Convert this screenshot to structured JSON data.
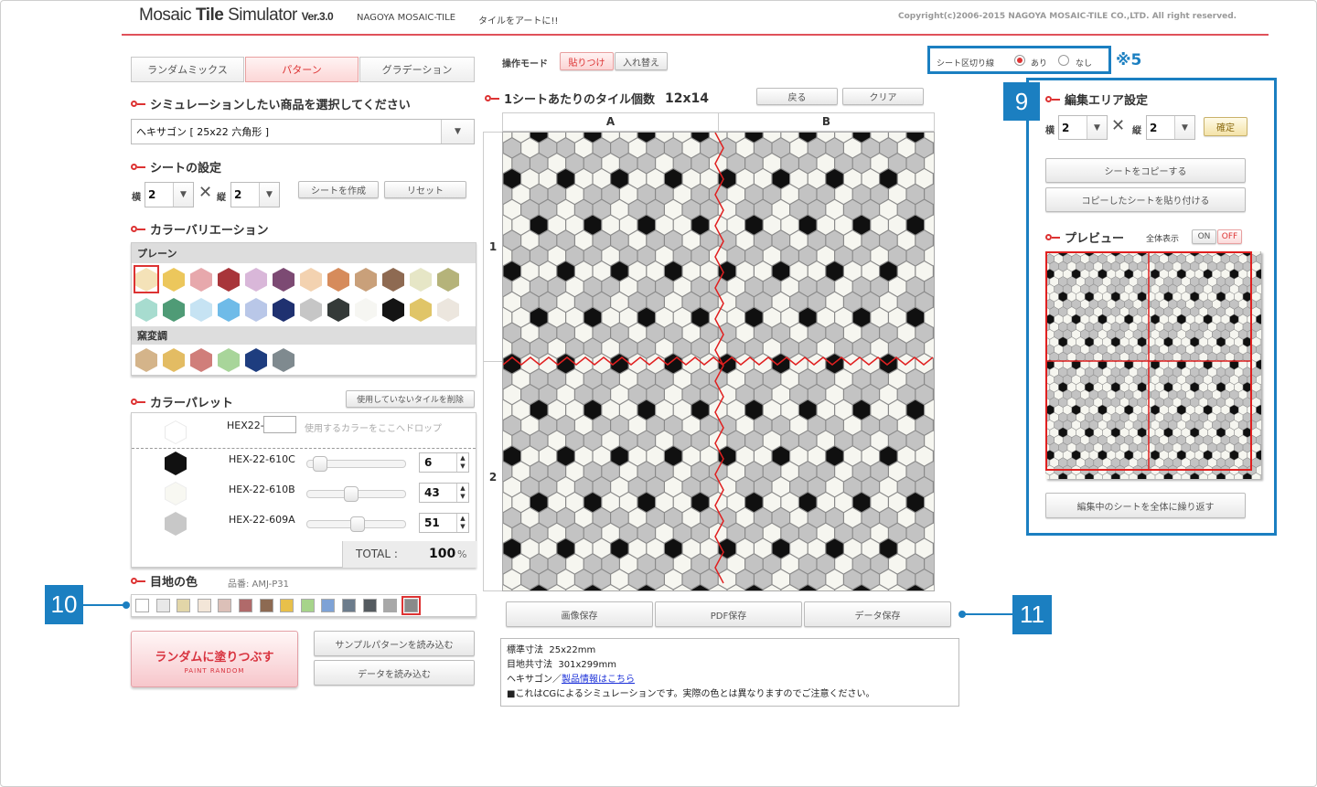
{
  "header": {
    "logo_main": "Mosaic ",
    "logo_bold": "Tile",
    "logo_rest": " Simulator ",
    "version": "Ver.3.0",
    "company": "NAGOYA MOSAIC-TILE",
    "slogan": "タイルをアートに!!",
    "copyright": "Copyright(c)2006-2015 NAGOYA MOSAIC-TILE CO.,LTD. All right reserved."
  },
  "tabs": [
    "ランダムミックス",
    "パターン",
    "グラデーション"
  ],
  "active_tab": 1,
  "product": {
    "title": "シミュレーションしたい商品を選択してください",
    "selected": "ヘキサゴン [ 25x22 六角形 ]"
  },
  "sheet": {
    "title": "シートの設定",
    "h_label": "横",
    "h_value": "2",
    "v_label": "縦",
    "v_value": "2",
    "create_btn": "シートを作成",
    "reset_btn": "リセット"
  },
  "variation": {
    "title": "カラーバリエーション",
    "group1": "プレーン",
    "group2": "窯変調",
    "row1": [
      "#f4e2b8",
      "#ecc75c",
      "#e7a8ac",
      "#a8353a",
      "#d9b7d9",
      "#7c4a73",
      "#f3d2b0",
      "#d68b5b",
      "#c9a07a",
      "#8e6a52",
      "#e6e6c6",
      "#b5b37a"
    ],
    "row2": [
      "#a7dccf",
      "#4f9b76",
      "#c6e3f3",
      "#6fbbe8",
      "#b9c7e8",
      "#1f3170",
      "#c6c6c6",
      "#343a38",
      "#f6f6f2",
      "#141414",
      "#e0c568",
      "#ece6de"
    ],
    "row3": [
      "#d4b48a",
      "#e3bc63",
      "#d07e7a",
      "#a8d59a",
      "#1e3d7f",
      "#7f8a8f"
    ]
  },
  "palette": {
    "title": "カラーパレット",
    "delete_btn": "使用していないタイルを削除",
    "drop_label": "HEX22-",
    "drop_hint": "使用するカラーをここへドロップ",
    "items": [
      {
        "code": "HEX-22-610C",
        "value": "6",
        "color": "#111111",
        "level": 0.06
      },
      {
        "code": "HEX-22-610B",
        "value": "43",
        "color": "#f8f8f2",
        "level": 0.43
      },
      {
        "code": "HEX-22-609A",
        "value": "51",
        "color": "#c8c8c8",
        "level": 0.51
      }
    ],
    "total_label": "TOTAL :",
    "total_value": "100",
    "total_unit": "%"
  },
  "grout": {
    "title": "目地の色",
    "code": "品番: AMJ-P31",
    "colors": [
      "#ffffff",
      "#e8e8e8",
      "#e2d6a8",
      "#f3e6d8",
      "#dcc0b8",
      "#b06a6a",
      "#8d6a52",
      "#e8c04a",
      "#a6d48a",
      "#7ea2d6",
      "#6c7c8c",
      "#555b60",
      "#a8a8a8",
      "#8a8a8a"
    ],
    "selected": 13
  },
  "random_btn": {
    "main": "ランダムに塗りつぶす",
    "sub": "PAINT RANDOM"
  },
  "load_sample_btn": "サンプルパターンを読み込む",
  "load_data_btn": "データを読み込む",
  "mode": {
    "label": "操作モード",
    "paste": "貼りつけ",
    "replace": "入れ替え"
  },
  "canvas": {
    "title": "1シートあたりのタイル個数",
    "count": "12x14",
    "back_btn": "戻る",
    "clear_btn": "クリア",
    "col_a": "A",
    "col_b": "B",
    "row_1": "1",
    "row_2": "2"
  },
  "save": {
    "image": "画像保存",
    "pdf": "PDF保存",
    "data": "データ保存"
  },
  "info": {
    "size_label": "標準寸法",
    "size": "25x22mm",
    "joint_label": "目地共寸法",
    "joint": "301x299mm",
    "product_prefix": "ヘキサゴン／",
    "product_link": "製品情報はこちら",
    "note": "■これはCGによるシミュレーションです。実際の色とは異なりますのでご注意ください。"
  },
  "divider": {
    "label": "シート区切り線",
    "yes": "あり",
    "no": "なし",
    "note": "※5"
  },
  "edit_area": {
    "title": "編集エリア設定",
    "h_label": "横",
    "h_value": "2",
    "v_label": "縦",
    "v_value": "2",
    "confirm": "確定",
    "copy_btn": "シートをコピーする",
    "paste_btn": "コピーしたシートを貼り付ける",
    "repeat_btn": "編集中のシートを全体に繰り返す"
  },
  "preview": {
    "title": "プレビュー",
    "full_label": "全体表示",
    "on": "ON",
    "off": "OFF"
  },
  "callouts": {
    "c9": "9",
    "c10": "10",
    "c11": "11"
  },
  "colors": {
    "accent": "#dd3333",
    "callout": "#1b7fc1",
    "sheet_line": "#e02020"
  }
}
